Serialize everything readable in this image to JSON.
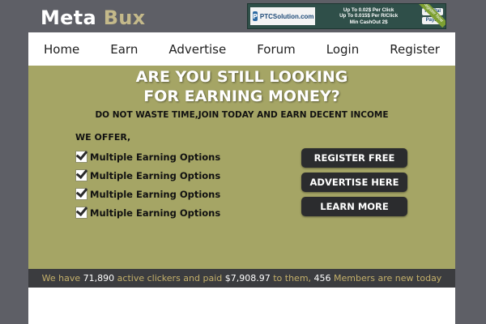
{
  "brand": {
    "word1": "Meta",
    "word2": "Bux"
  },
  "banner": {
    "logo_text": "PTCSolution.com",
    "line1": "Up To 0.02$ Per Click",
    "line2": "Up To 0.015$ Per R/Click",
    "line3": "Min CashOut 2$",
    "pay1": "PayPal",
    "pay2": "Payza",
    "ribbon": "Register Now"
  },
  "nav": {
    "items": [
      "Home",
      "Earn",
      "Advertise",
      "Forum",
      "Login",
      "Register"
    ]
  },
  "hero": {
    "headline_line1": "ARE YOU STILL LOOKING",
    "headline_line2": "FOR EARNING MONEY?",
    "subheadline": "DO NOT WASTE TIME,JOIN TODAY AND EARN DECENT INCOME",
    "offer_label": "WE OFFER,",
    "features": [
      "Multiple Earning Options",
      "Multiple Earning Options",
      "Multiple Earning Options",
      "Multiple Earning Options"
    ],
    "buttons": {
      "register": "REGISTER FREE",
      "advertise": "ADVERTISE HERE",
      "learn": "LEARN MORE"
    }
  },
  "stats": {
    "t1": "We have",
    "clickers": "71,890",
    "t2": "active clickers and paid",
    "paid": "$7,908.97",
    "t3": "to them,",
    "members": "456",
    "t4": "Members are new today"
  },
  "colors": {
    "background": "#5e5f66",
    "hero": "#a5a565",
    "brand_accent": "#c4b98a",
    "button": "#2b2c2e",
    "stats_bar": "#3b3c3f",
    "stats_text": "#c4b06a"
  }
}
